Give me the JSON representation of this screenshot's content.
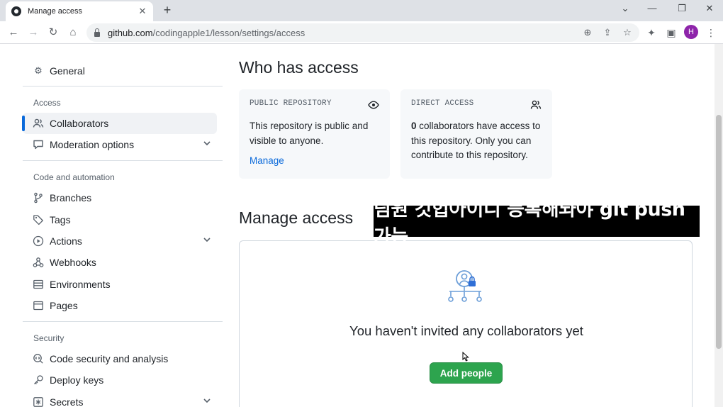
{
  "browser": {
    "tab_title": "Manage access",
    "url_host": "github.com",
    "url_path": "/codingapple1/lesson/settings/access",
    "avatar_letter": "H"
  },
  "sidebar": {
    "general": "General",
    "access_heading": "Access",
    "collaborators": "Collaborators",
    "moderation": "Moderation options",
    "code_heading": "Code and automation",
    "branches": "Branches",
    "tags": "Tags",
    "actions": "Actions",
    "webhooks": "Webhooks",
    "environments": "Environments",
    "pages": "Pages",
    "security_heading": "Security",
    "code_security": "Code security and analysis",
    "deploy_keys": "Deploy keys",
    "secrets": "Secrets"
  },
  "main": {
    "who_title": "Who has access",
    "public_card": {
      "label": "PUBLIC REPOSITORY",
      "text": "This repository is public and visible to anyone.",
      "link": "Manage"
    },
    "direct_card": {
      "label": "DIRECT ACCESS",
      "count": "0",
      "text": " collaborators have access to this repository. Only you can contribute to this repository."
    },
    "manage_title": "Manage access",
    "empty_title": "You haven't invited any collaborators yet",
    "add_button": "Add people"
  },
  "caption": "팀원 깃헙아이디 등록해놔야 git push 가능"
}
